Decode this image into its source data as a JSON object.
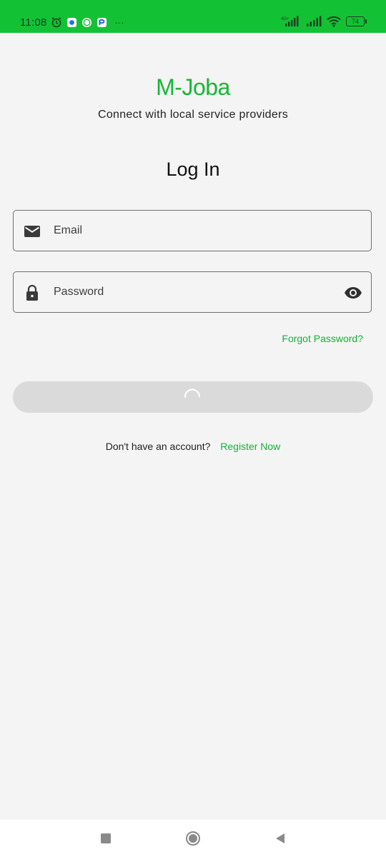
{
  "status_bar": {
    "time": "11:08",
    "battery": "74",
    "network": "4G+",
    "more": "···"
  },
  "brand": {
    "name": "M-Joba",
    "tagline": "Connect with local service providers"
  },
  "login": {
    "title": "Log In",
    "email_placeholder": "Email",
    "email_value": "",
    "password_placeholder": "Password",
    "password_value": "",
    "forgot_label": "Forgot Password?",
    "register_prompt": "Don't have an account?",
    "register_label": "Register Now"
  },
  "colors": {
    "accent": "#13c234",
    "text": "#111111",
    "background": "#f4f4f4",
    "button_disabled": "#dadada"
  },
  "icons": {
    "email": "mail-icon",
    "password": "lock-icon",
    "visibility": "eye-icon",
    "loading": "spinner-icon"
  }
}
